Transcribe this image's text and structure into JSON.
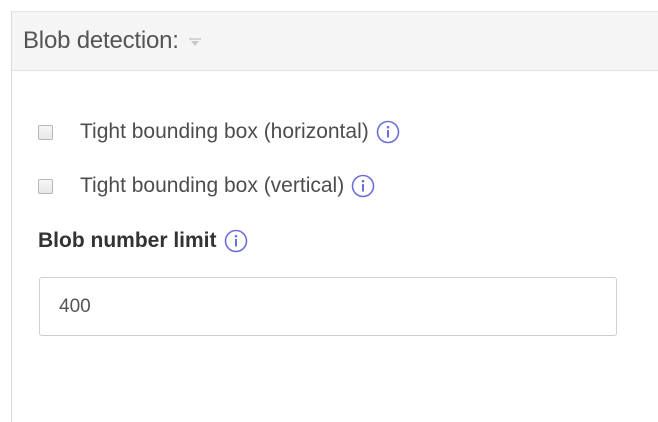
{
  "panel": {
    "title": "Blob detection:",
    "options": [
      {
        "label": "Tight bounding box (horizontal)",
        "checked": false
      },
      {
        "label": "Tight bounding box (vertical)",
        "checked": false
      }
    ],
    "blob_limit": {
      "label": "Blob number limit",
      "value": "400"
    }
  },
  "colors": {
    "info_icon": "#6c6fd9",
    "header_bg": "#f5f5f5"
  },
  "icons": {
    "collapse": "caret-down-icon",
    "info": "info-icon"
  }
}
